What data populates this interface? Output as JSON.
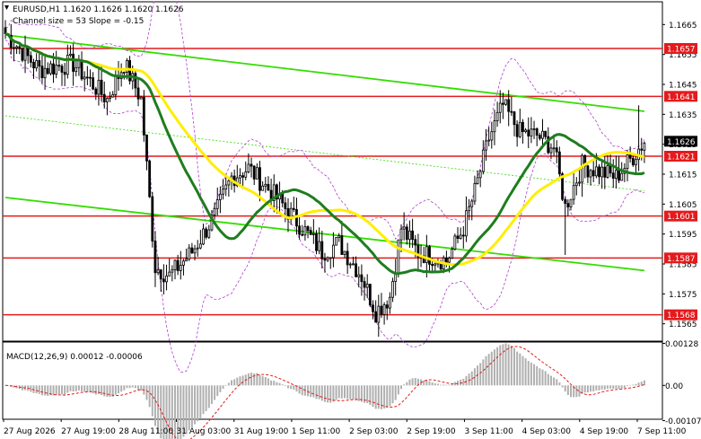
{
  "header": {
    "symbol_line": "EURUSD,H1  1.1620 1.1626 1.1620 1.1626",
    "channel_line": "Channel size = 53 Slope = -0.15"
  },
  "macd_label": "MACD(12,26,9) 0.00012 -0.00006",
  "colors": {
    "level_line": "#e41a1c",
    "channel": "#33dd00",
    "ma_fast": "#ffee00",
    "ma_slow": "#1e7d1e",
    "bands": "#b040d0",
    "candles": "#000000",
    "macd_hist": "#b0b0b0",
    "macd_signal": "#e41a1c"
  },
  "chart_data": [
    {
      "type": "candlestick",
      "symbol": "EURUSD",
      "timeframe": "H1",
      "ylim": [
        1.15592,
        1.16726
      ],
      "y_ticks": [
        "1.1665",
        "1.1655",
        "1.1645",
        "1.1635",
        "1.1625",
        "1.1615",
        "1.1605",
        "1.1595",
        "1.1585",
        "1.1575",
        "1.1565"
      ],
      "x_ticks": [
        "27 Aug 2026",
        "27 Aug 19:00",
        "28 Aug 11:00",
        "31 Aug 03:00",
        "31 Aug 19:00",
        "1 Sep 11:00",
        "2 Sep 03:00",
        "2 Sep 19:00",
        "3 Sep 11:00",
        "4 Sep 03:00",
        "4 Sep 19:00",
        "7 Sep 11:00"
      ],
      "levels": [
        "1.1657",
        "1.1641",
        "1.1621",
        "1.1601",
        "1.1587",
        "1.1568"
      ],
      "current_price": "1.1626",
      "close_anchors": [
        [
          0,
          1.1662
        ],
        [
          12,
          1.165
        ],
        [
          24,
          1.1652
        ],
        [
          36,
          1.164
        ],
        [
          42,
          1.1652
        ],
        [
          48,
          1.164
        ],
        [
          53,
          1.1584
        ],
        [
          58,
          1.1581
        ],
        [
          66,
          1.1589
        ],
        [
          74,
          1.1601
        ],
        [
          80,
          1.1614
        ],
        [
          86,
          1.1617
        ],
        [
          96,
          1.1607
        ],
        [
          106,
          1.1596
        ],
        [
          112,
          1.1589
        ],
        [
          118,
          1.1592
        ],
        [
          126,
          1.1581
        ],
        [
          131,
          1.1569
        ],
        [
          136,
          1.1574
        ],
        [
          140,
          1.1597
        ],
        [
          146,
          1.1589
        ],
        [
          156,
          1.1586
        ],
        [
          162,
          1.1597
        ],
        [
          166,
          1.1609
        ],
        [
          171,
          1.1627
        ],
        [
          176,
          1.1638
        ],
        [
          182,
          1.1629
        ],
        [
          188,
          1.1628
        ],
        [
          194,
          1.1624
        ],
        [
          198,
          1.1604
        ],
        [
          204,
          1.1618
        ],
        [
          210,
          1.1616
        ],
        [
          216,
          1.1614
        ],
        [
          222,
          1.1621
        ],
        [
          226,
          1.1626
        ]
      ],
      "channel": {
        "upper": [
          [
            0,
            1.16615
          ],
          [
            226,
            1.1636
          ]
        ],
        "lower": [
          [
            0,
            1.16072
          ],
          [
            226,
            1.15828
          ]
        ],
        "middle": [
          [
            0,
            1.16345
          ],
          [
            226,
            1.16094
          ]
        ]
      }
    },
    {
      "type": "macd",
      "params": "12,26,9",
      "value": 0.00012,
      "signal": -6e-05,
      "ylim": [
        -0.00103,
        0.00132
      ],
      "y_ticks": [
        "0.00128",
        "0.00",
        "-0.00107"
      ]
    }
  ]
}
